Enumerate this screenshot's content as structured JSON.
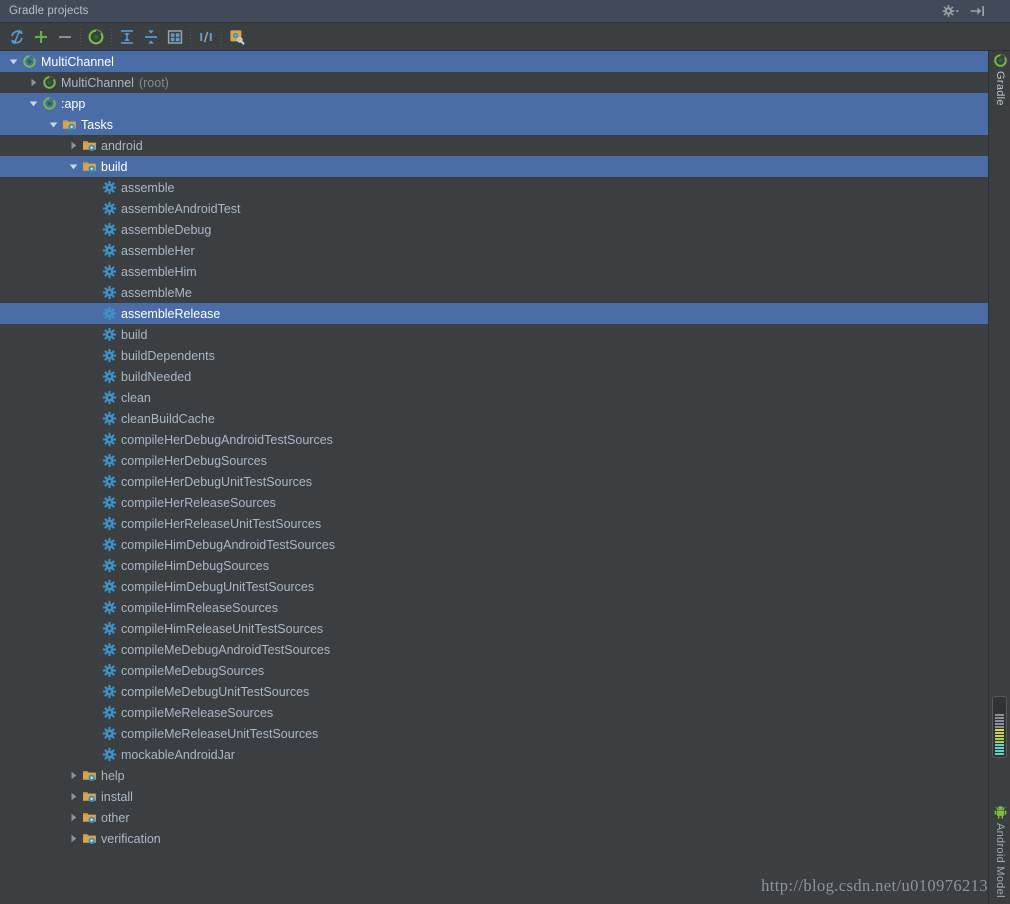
{
  "window": {
    "title": "Gradle projects"
  },
  "titlebar_buttons": [
    {
      "name": "settings-gear-dropdown",
      "icon": "gear-dropdown-icon",
      "label": "Settings"
    },
    {
      "name": "hide-tool-window",
      "icon": "hide-window-icon",
      "label": "Hide"
    }
  ],
  "toolbar": {
    "buttons": [
      {
        "name": "refresh-button",
        "icon": "refresh-icon",
        "label": "Refresh all Gradle projects"
      },
      {
        "name": "add-button",
        "icon": "plus-icon",
        "label": "Link Gradle project"
      },
      {
        "name": "remove-button",
        "icon": "minus-icon",
        "label": "Detach external project"
      },
      {
        "name": "separator-1",
        "icon": "separator",
        "label": ""
      },
      {
        "name": "execute-task-button",
        "icon": "run-gradle-icon",
        "label": "Execute Gradle Task"
      },
      {
        "name": "separator-2",
        "icon": "separator",
        "label": ""
      },
      {
        "name": "expand-all-button",
        "icon": "expand-all-icon",
        "label": "Expand All"
      },
      {
        "name": "collapse-all-button",
        "icon": "collapse-all-icon",
        "label": "Collapse All"
      },
      {
        "name": "group-modules-button",
        "icon": "group-modules-icon",
        "label": "Group Tasks"
      },
      {
        "name": "separator-3",
        "icon": "separator",
        "label": ""
      },
      {
        "name": "toggle-offline-button",
        "icon": "offline-mode-icon",
        "label": "Toggle Offline Mode"
      },
      {
        "name": "separator-4",
        "icon": "separator",
        "label": ""
      },
      {
        "name": "gradle-settings-button",
        "icon": "gradle-settings-icon",
        "label": "Gradle Settings"
      }
    ]
  },
  "tree": {
    "rows": [
      {
        "indent": 0,
        "twisty": "down",
        "icon": "gradle-icon",
        "label": "MultiChannel",
        "sub": "",
        "selected": true
      },
      {
        "indent": 1,
        "twisty": "right",
        "icon": "gradle-icon",
        "label": "MultiChannel",
        "sub": "(root)",
        "selected": false
      },
      {
        "indent": 1,
        "twisty": "down",
        "icon": "gradle-icon",
        "label": ":app",
        "sub": "",
        "selected": true
      },
      {
        "indent": 2,
        "twisty": "down",
        "icon": "folder-icon",
        "label": "Tasks",
        "sub": "",
        "selected": true
      },
      {
        "indent": 3,
        "twisty": "right",
        "icon": "folder-icon",
        "label": "android",
        "sub": "",
        "selected": false
      },
      {
        "indent": 3,
        "twisty": "down",
        "icon": "folder-icon",
        "label": "build",
        "sub": "",
        "selected": true
      },
      {
        "indent": 4,
        "twisty": "none",
        "icon": "task-icon",
        "label": "assemble",
        "sub": "",
        "selected": false
      },
      {
        "indent": 4,
        "twisty": "none",
        "icon": "task-icon",
        "label": "assembleAndroidTest",
        "sub": "",
        "selected": false
      },
      {
        "indent": 4,
        "twisty": "none",
        "icon": "task-icon",
        "label": "assembleDebug",
        "sub": "",
        "selected": false
      },
      {
        "indent": 4,
        "twisty": "none",
        "icon": "task-icon",
        "label": "assembleHer",
        "sub": "",
        "selected": false
      },
      {
        "indent": 4,
        "twisty": "none",
        "icon": "task-icon",
        "label": "assembleHim",
        "sub": "",
        "selected": false
      },
      {
        "indent": 4,
        "twisty": "none",
        "icon": "task-icon",
        "label": "assembleMe",
        "sub": "",
        "selected": false
      },
      {
        "indent": 4,
        "twisty": "none",
        "icon": "task-icon",
        "label": "assembleRelease",
        "sub": "",
        "selected": true
      },
      {
        "indent": 4,
        "twisty": "none",
        "icon": "task-icon",
        "label": "build",
        "sub": "",
        "selected": false
      },
      {
        "indent": 4,
        "twisty": "none",
        "icon": "task-icon",
        "label": "buildDependents",
        "sub": "",
        "selected": false
      },
      {
        "indent": 4,
        "twisty": "none",
        "icon": "task-icon",
        "label": "buildNeeded",
        "sub": "",
        "selected": false
      },
      {
        "indent": 4,
        "twisty": "none",
        "icon": "task-icon",
        "label": "clean",
        "sub": "",
        "selected": false
      },
      {
        "indent": 4,
        "twisty": "none",
        "icon": "task-icon",
        "label": "cleanBuildCache",
        "sub": "",
        "selected": false
      },
      {
        "indent": 4,
        "twisty": "none",
        "icon": "task-icon",
        "label": "compileHerDebugAndroidTestSources",
        "sub": "",
        "selected": false
      },
      {
        "indent": 4,
        "twisty": "none",
        "icon": "task-icon",
        "label": "compileHerDebugSources",
        "sub": "",
        "selected": false
      },
      {
        "indent": 4,
        "twisty": "none",
        "icon": "task-icon",
        "label": "compileHerDebugUnitTestSources",
        "sub": "",
        "selected": false
      },
      {
        "indent": 4,
        "twisty": "none",
        "icon": "task-icon",
        "label": "compileHerReleaseSources",
        "sub": "",
        "selected": false
      },
      {
        "indent": 4,
        "twisty": "none",
        "icon": "task-icon",
        "label": "compileHerReleaseUnitTestSources",
        "sub": "",
        "selected": false
      },
      {
        "indent": 4,
        "twisty": "none",
        "icon": "task-icon",
        "label": "compileHimDebugAndroidTestSources",
        "sub": "",
        "selected": false
      },
      {
        "indent": 4,
        "twisty": "none",
        "icon": "task-icon",
        "label": "compileHimDebugSources",
        "sub": "",
        "selected": false
      },
      {
        "indent": 4,
        "twisty": "none",
        "icon": "task-icon",
        "label": "compileHimDebugUnitTestSources",
        "sub": "",
        "selected": false
      },
      {
        "indent": 4,
        "twisty": "none",
        "icon": "task-icon",
        "label": "compileHimReleaseSources",
        "sub": "",
        "selected": false
      },
      {
        "indent": 4,
        "twisty": "none",
        "icon": "task-icon",
        "label": "compileHimReleaseUnitTestSources",
        "sub": "",
        "selected": false
      },
      {
        "indent": 4,
        "twisty": "none",
        "icon": "task-icon",
        "label": "compileMeDebugAndroidTestSources",
        "sub": "",
        "selected": false
      },
      {
        "indent": 4,
        "twisty": "none",
        "icon": "task-icon",
        "label": "compileMeDebugSources",
        "sub": "",
        "selected": false
      },
      {
        "indent": 4,
        "twisty": "none",
        "icon": "task-icon",
        "label": "compileMeDebugUnitTestSources",
        "sub": "",
        "selected": false
      },
      {
        "indent": 4,
        "twisty": "none",
        "icon": "task-icon",
        "label": "compileMeReleaseSources",
        "sub": "",
        "selected": false
      },
      {
        "indent": 4,
        "twisty": "none",
        "icon": "task-icon",
        "label": "compileMeReleaseUnitTestSources",
        "sub": "",
        "selected": false
      },
      {
        "indent": 4,
        "twisty": "none",
        "icon": "task-icon",
        "label": "mockableAndroidJar",
        "sub": "",
        "selected": false
      },
      {
        "indent": 3,
        "twisty": "right",
        "icon": "folder-icon",
        "label": "help",
        "sub": "",
        "selected": false
      },
      {
        "indent": 3,
        "twisty": "right",
        "icon": "folder-icon",
        "label": "install",
        "sub": "",
        "selected": false
      },
      {
        "indent": 3,
        "twisty": "right",
        "icon": "folder-icon",
        "label": "other",
        "sub": "",
        "selected": false
      },
      {
        "indent": 3,
        "twisty": "right",
        "icon": "folder-icon",
        "label": "verification",
        "sub": "",
        "selected": false
      }
    ]
  },
  "sidebar": {
    "top_tab": {
      "label": "Gradle",
      "icon": "gradle-icon"
    },
    "bottom_tab": {
      "label": "Android Model",
      "icon": "android-robot-icon"
    }
  },
  "memory_widget": {
    "name": "memory-indicator",
    "bars": [
      "#63d3c8",
      "#63d3c8",
      "#63d3c8",
      "#63d3c8",
      "#9fd14a",
      "#9fd14a",
      "#c9d14a",
      "#c9d14a",
      "#d7d94a",
      "#8a9096",
      "#8a9096",
      "#8a9096",
      "#8a9096",
      "#8a9096"
    ]
  },
  "watermark": {
    "text": "http://blog.csdn.net/u010976213"
  },
  "colors": {
    "background": "#3c3f41",
    "titlebar": "#414a58",
    "selection": "#4a6da7",
    "text": "#a9b7c6",
    "text_dim": "#808b94",
    "accent_green": "#499c54",
    "accent_blue": "#3592c4",
    "folder_orange": "#d9a54a"
  }
}
